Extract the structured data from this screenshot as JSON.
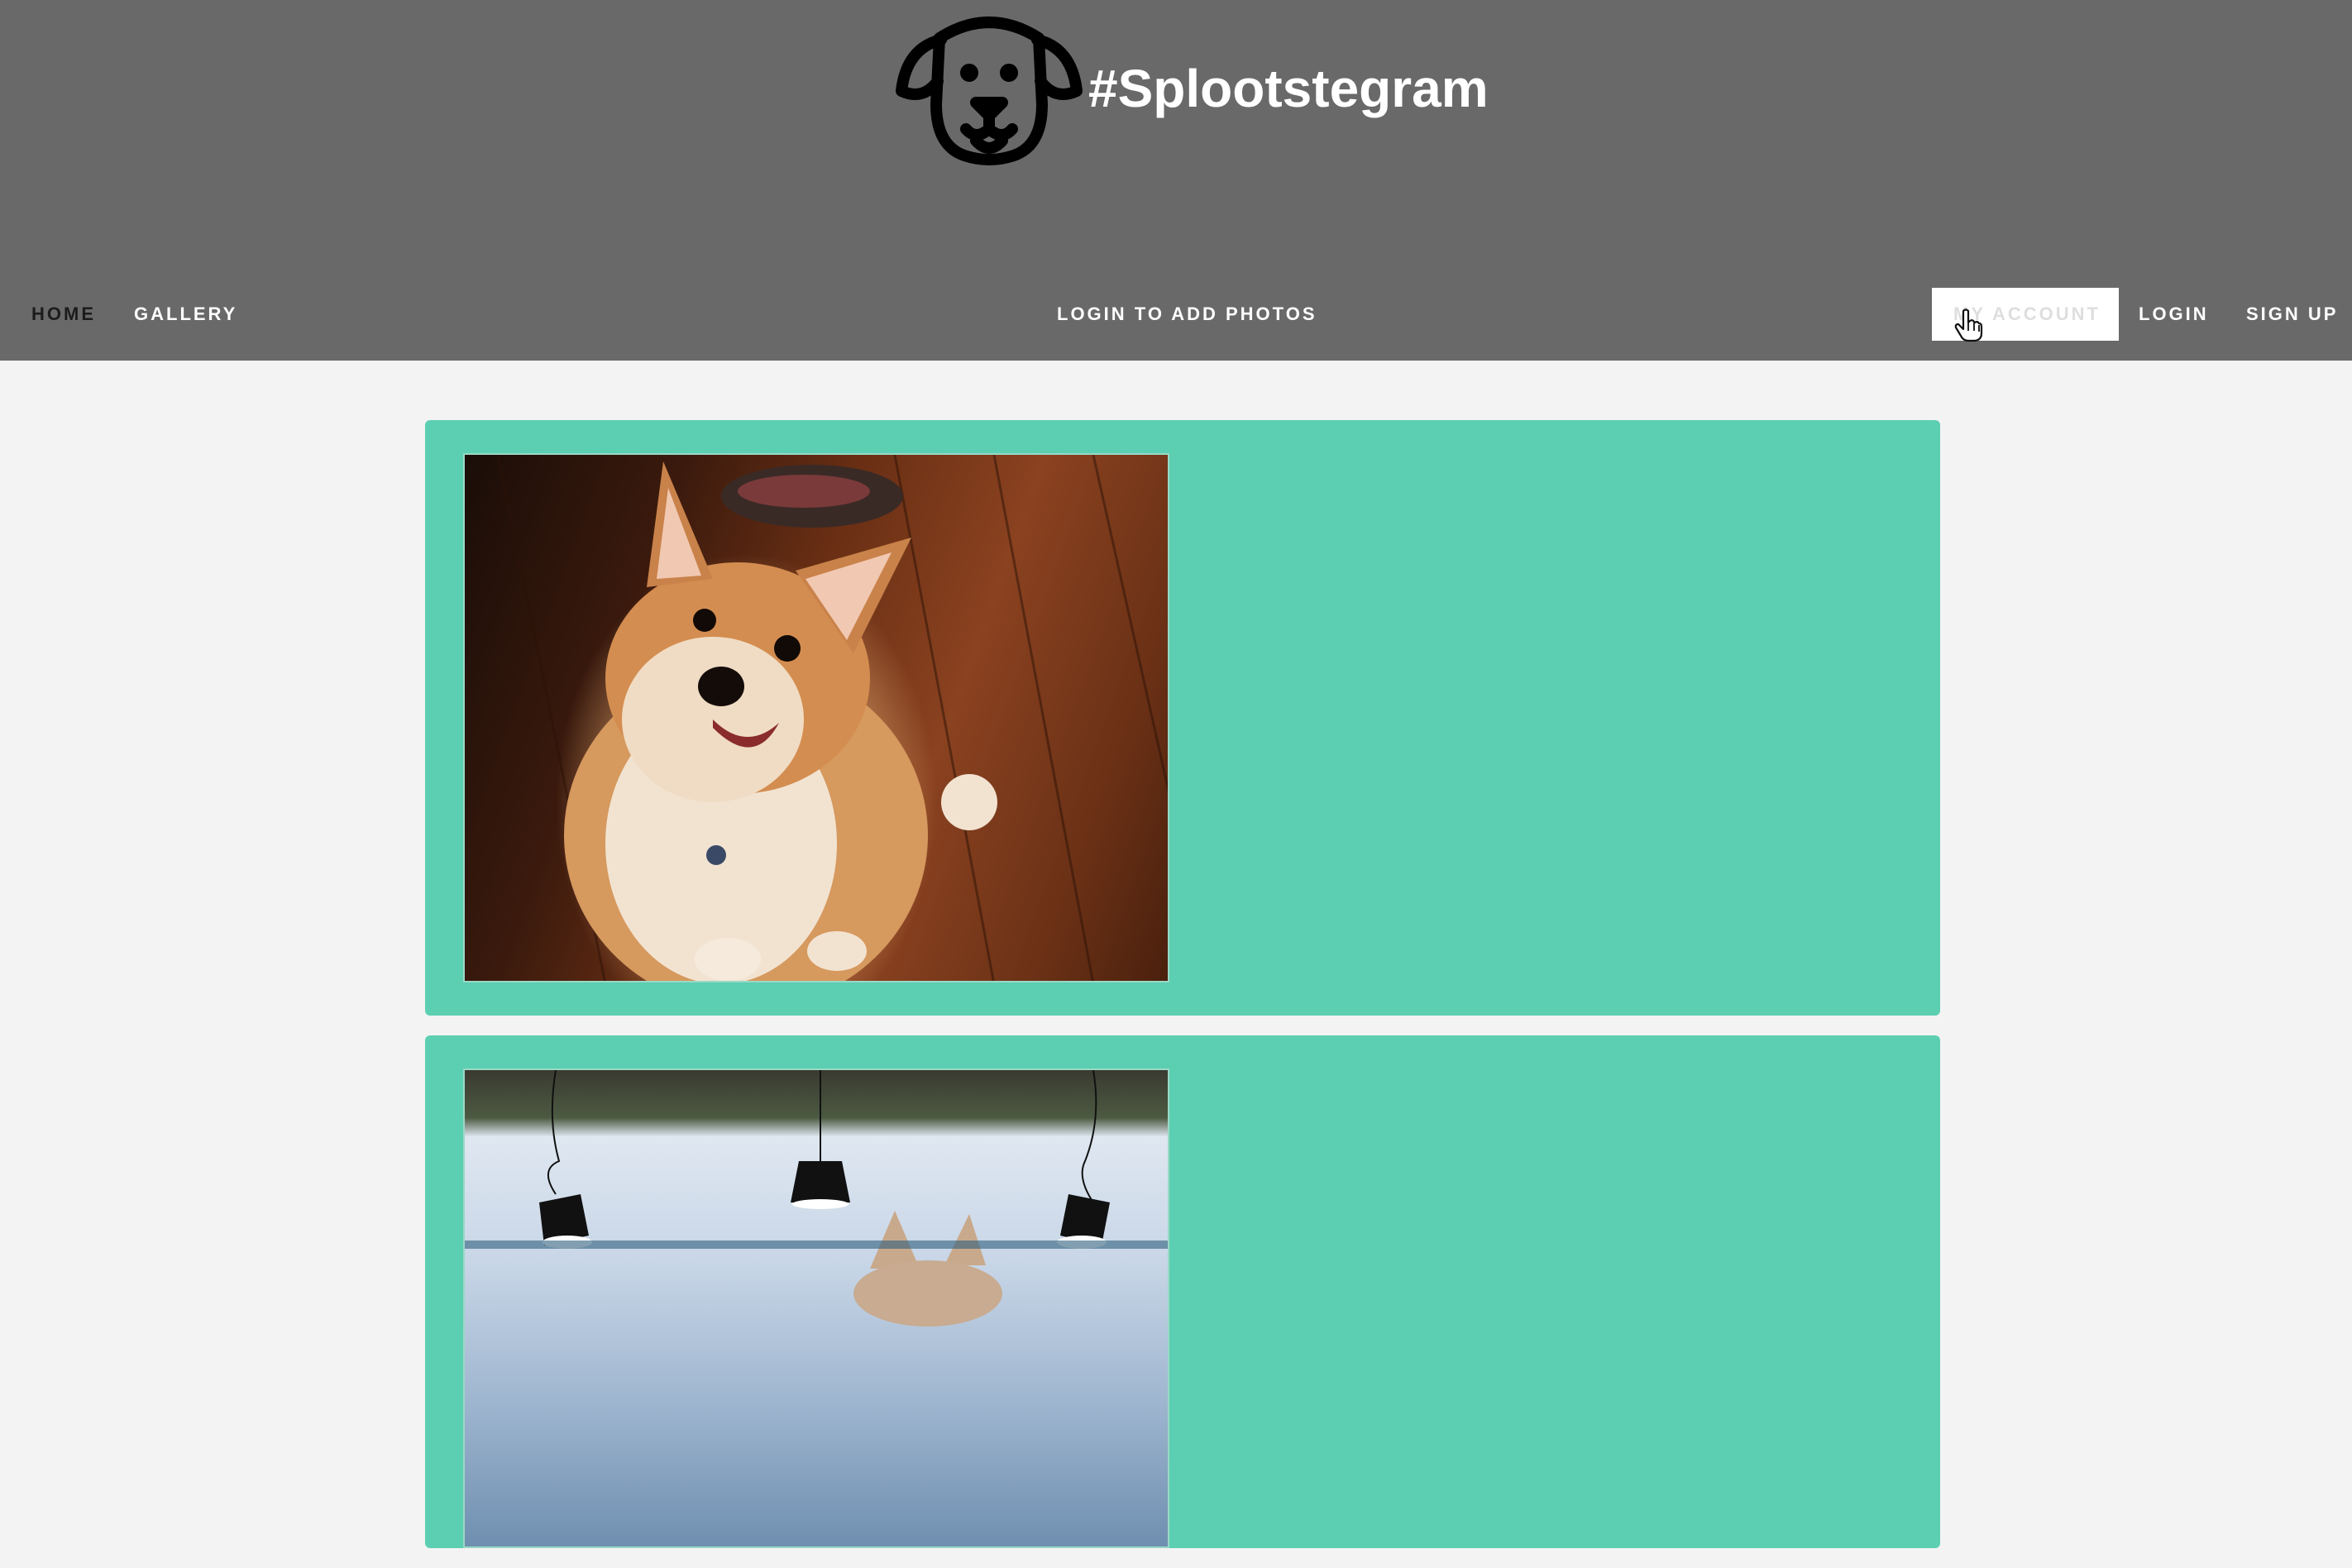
{
  "header": {
    "brand_title": "#Splootstegram",
    "logo_icon": "dog-face-icon"
  },
  "nav": {
    "home": "HOME",
    "gallery": "GALLERY",
    "center_notice": "LOGIN TO ADD PHOTOS",
    "my_account": "MY ACCOUNT",
    "login": "LOGIN",
    "sign_up": "SIGN UP"
  },
  "colors": {
    "header_bg": "#696969",
    "page_bg": "#f3f3f3",
    "card_bg": "#5ccfb2",
    "nav_text": "#ffffff",
    "nav_active": "#1c1c1c"
  },
  "feed": {
    "posts": [
      {
        "photo": "corgi-on-wood-floor"
      },
      {
        "photo": "corgi-by-pool"
      }
    ]
  }
}
